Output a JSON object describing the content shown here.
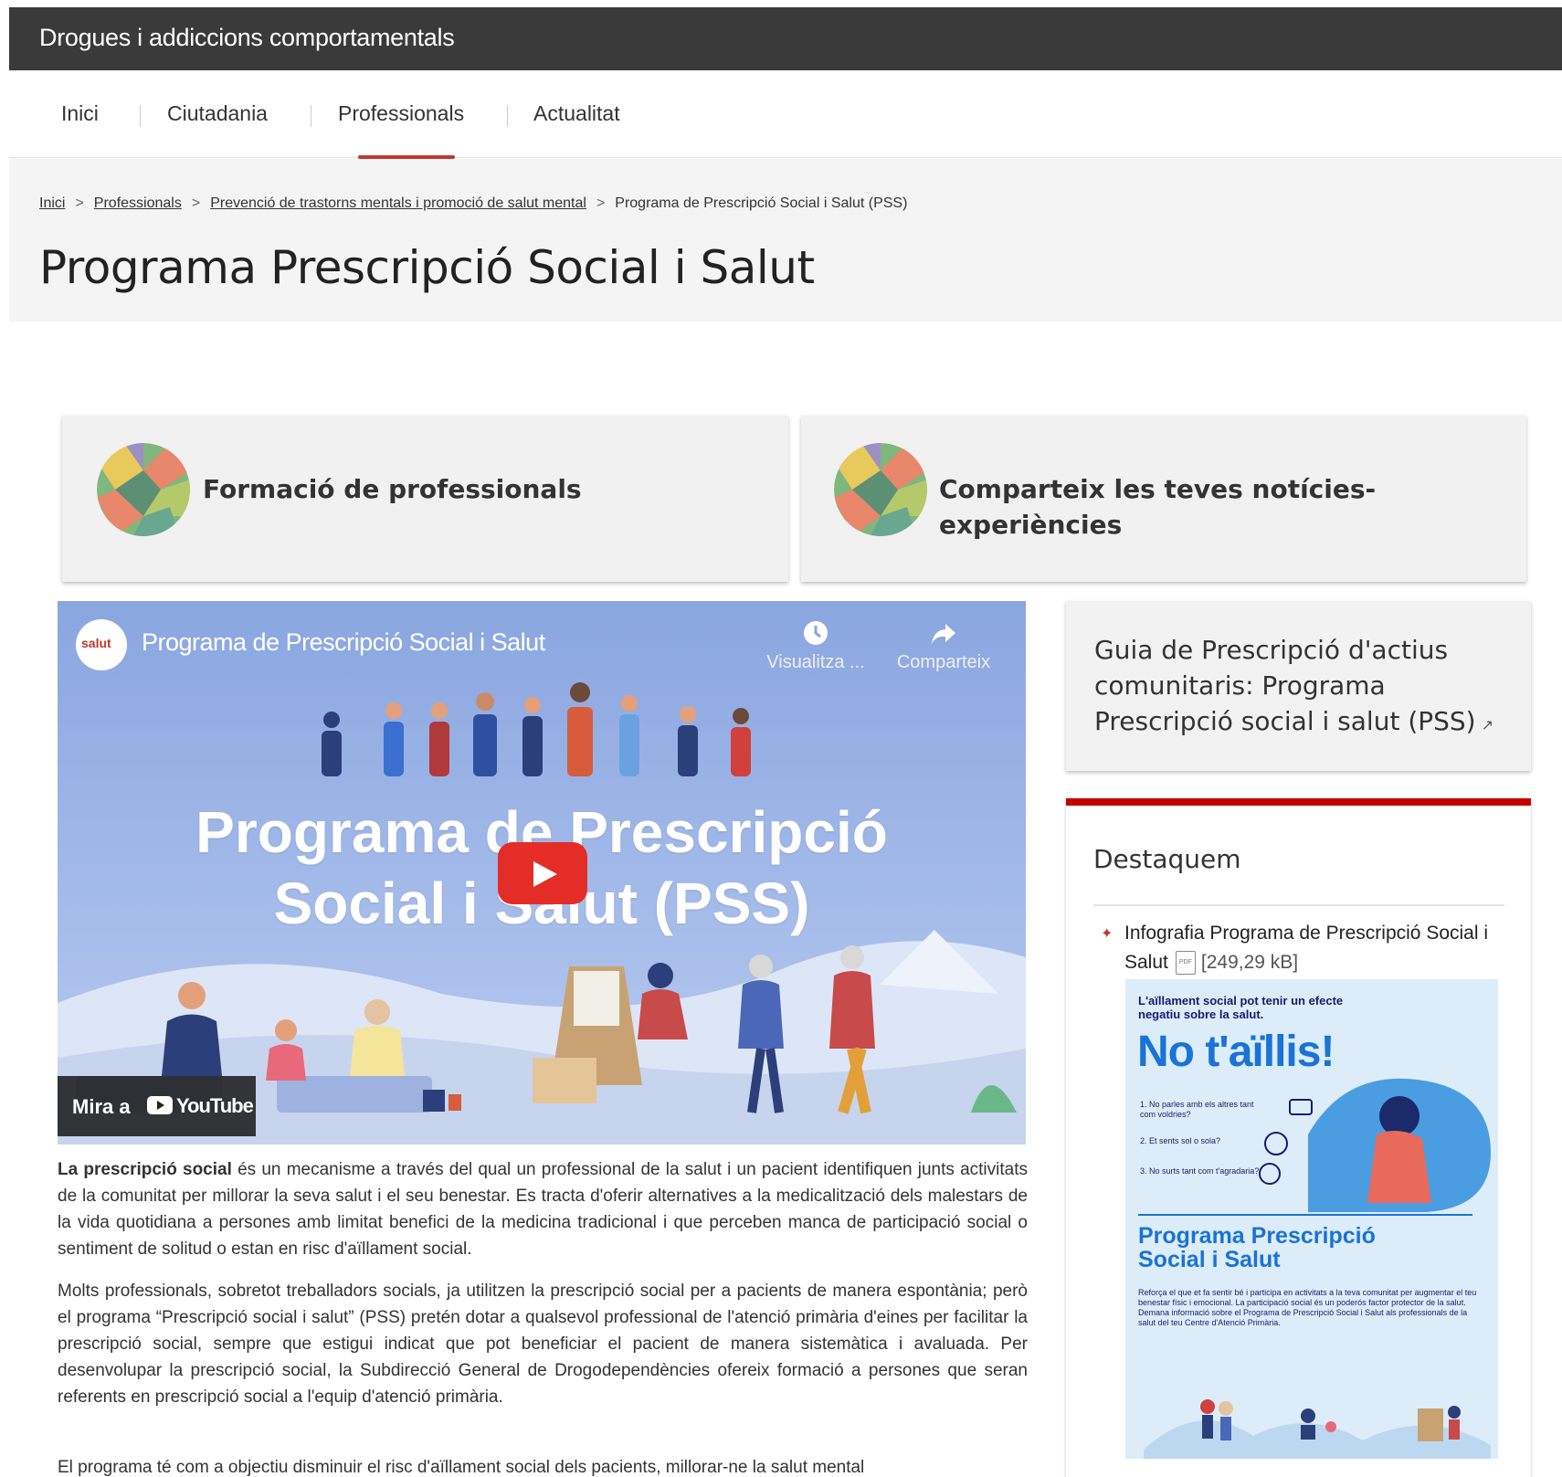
{
  "site": {
    "title": "Drogues i addiccions comportamentals"
  },
  "nav": {
    "items": [
      "Inici",
      "Ciutadania",
      "Professionals",
      "Actualitat"
    ],
    "active": "Professionals"
  },
  "breadcrumb": {
    "items": [
      "Inici",
      "Professionals",
      "Prevenció de trastorns mentals i promoció de salut mental"
    ],
    "current": "Programa de Prescripció Social i Salut (PSS)"
  },
  "page": {
    "title": "Programa Prescripció Social i Salut"
  },
  "cards": [
    {
      "label": "Formació de professionals"
    },
    {
      "label": "Comparteix les teves notícies-experiències"
    }
  ],
  "video": {
    "channel": "salut",
    "title": "Programa de Prescripció Social i Salut",
    "watch_later": "Visualitza ...",
    "share": "Comparteix",
    "headline_1": "Programa de Prescripció",
    "headline_2": "Social i Salut (PSS)",
    "watch_on": "Mira a",
    "youtube": "YouTube"
  },
  "content": {
    "p1_bold": "La prescripció social",
    "p1_rest": " és un mecanisme a través del qual un professional de la salut i un pacient identifiquen junts activitats de la comunitat per millorar la seva salut i el seu benestar. Es tracta d'oferir alternatives a la medicalització dels malestars de la vida quotidiana a persones amb limitat benefici de la medicina tradicional i que perceben manca de participació social o sentiment de solitud o estan en risc d'aïllament social.",
    "p2": "Molts professionals, sobretot treballadors socials, ja utilitzen la prescripció social per a pacients de manera espontània; però el programa “Prescripció social i salut” (PSS) pretén dotar a qualsevol professional de l'atenció primària d'eines per facilitar la prescripció social, sempre que estigui indicat que pot beneficiar el pacient de manera sistemàtica i avaluada. Per desenvolupar la prescripció social, la Subdirecció General de Drogodependències ofereix formació a persones que seran referents en prescripció social a l'equip d'atenció primària.",
    "p3": "El programa té com a objectiu disminuir el risc d'aïllament social dels pacients, millorar-ne la salut mental"
  },
  "sidebar": {
    "guide": "Guia de Prescripció d'actius comunitaris: Programa Prescripció social i salut (PSS)",
    "dest_title": "Destaquem",
    "doc_title": "Infografia Programa de Prescripció Social i Salut",
    "doc_type": "PDF",
    "doc_size": "[249,29 kB]",
    "infographic": {
      "intro": "L'aïllament social pot tenir un efecte negatiu sobre la salut.",
      "big": "No t'aïllis!",
      "q1": "1.  No parles amb els altres tant com voldries?",
      "q2": "2.  Et sents sol o sola?",
      "q3": "3.  No surts tant com t'agradaria?",
      "prog": "Programa Prescripció Social i Salut",
      "body": "Reforça el que et fa sentir bé i participa en activitats a la teva comunitat per augmentar el teu benestar físic i emocional. La participació social és un poderós factor protector de la salut. Demana informació sobre el Programa de Prescripció Social i Salut als professionals de la salut del teu Centre d'Atenció Primària."
    }
  },
  "colors": {
    "accent": "#c0392b",
    "topbar": "#3a3a3a",
    "video_bg": "#a8bfeb",
    "infographic_blue": "#1a73d6"
  }
}
